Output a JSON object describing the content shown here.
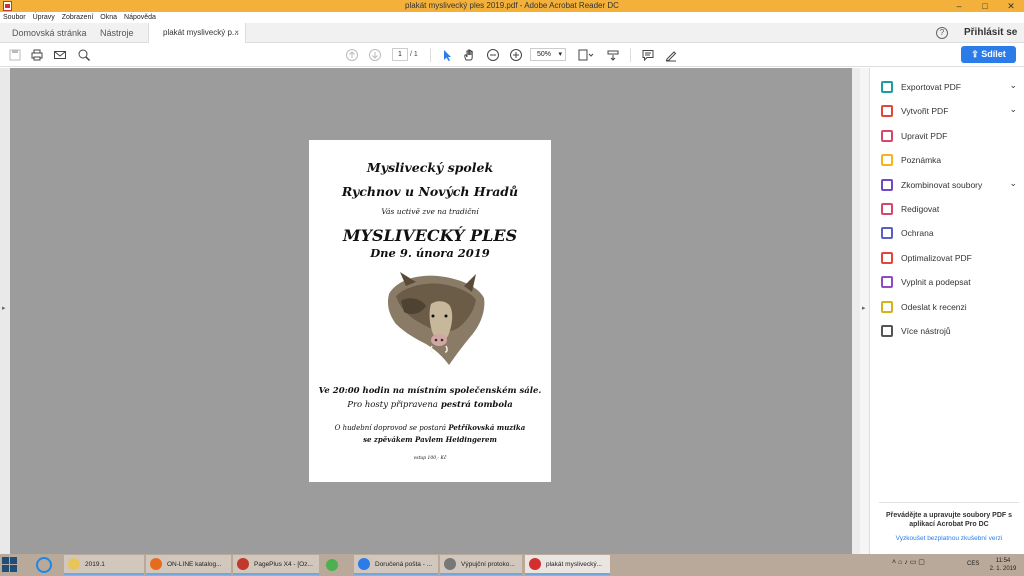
{
  "window": {
    "title": "plakát myslivecký ples 2019.pdf - Adobe Acrobat Reader DC",
    "controls": [
      "–",
      "□",
      "✕"
    ]
  },
  "menu": [
    "Soubor",
    "Úpravy",
    "Zobrazení",
    "Okna",
    "Nápověda"
  ],
  "tabs": {
    "home": "Domovská stránka",
    "tools": "Nástroje",
    "document": "plakát myslivecký p...",
    "close": "×"
  },
  "header": {
    "help": "?",
    "signin": "Přihlásit se"
  },
  "toolbar": {
    "page_current": "1",
    "page_total": "/ 1",
    "zoom": "50%",
    "share_label": "Sdílet"
  },
  "document": {
    "line1": "Myslivecký spolek",
    "line2": "Rychnov u Nových Hradů",
    "line3": "Vás uctivě zve na tradiční",
    "line4": "MYSLIVECKÝ PLES",
    "line5": "Dne 9. února 2019",
    "line6": "Ve 20:00 hodin na místním společenském sále.",
    "line7a": "Pro hosty připravena",
    "line7b": " pestrá tombola",
    "line8a": "O hudební doprovod se postará  ",
    "line8b": "Petříkovská muzika",
    "line9": "se zpěvákem Pavlem Heidingerem",
    "line10": "vstup 100,- Kč"
  },
  "right_panel": {
    "tools": [
      {
        "label": "Exportovat PDF",
        "color": "#1b9e9e",
        "chevron": true
      },
      {
        "label": "Vytvořit PDF",
        "color": "#e0463c",
        "chevron": true
      },
      {
        "label": "Upravit PDF",
        "color": "#d9456b",
        "chevron": false
      },
      {
        "label": "Poznámka",
        "color": "#f2b422",
        "chevron": false
      },
      {
        "label": "Zkombinovat soubory",
        "color": "#6e4bc3",
        "chevron": true
      },
      {
        "label": "Redigovat",
        "color": "#d9456b",
        "chevron": false
      },
      {
        "label": "Ochrana",
        "color": "#5a5fc8",
        "chevron": false
      },
      {
        "label": "Optimalizovat PDF",
        "color": "#e0463c",
        "chevron": false
      },
      {
        "label": "Vyplnit a podepsat",
        "color": "#8e4bc3",
        "chevron": false
      },
      {
        "label": "Odeslat k recenzi",
        "color": "#d3b21b",
        "chevron": false
      },
      {
        "label": "Více nástrojů",
        "color": "#555555",
        "chevron": false
      }
    ],
    "promo_text": "Převádějte a upravujte soubory PDF s aplikací Acrobat Pro DC",
    "promo_link": "Vyzkoušet bezplatnou zkušební verzi"
  },
  "taskbar": {
    "items": [
      {
        "label": "2019.1",
        "color": "#e8c55a"
      },
      {
        "label": "ON-LINE katalog...",
        "color": "#e66b1f"
      },
      {
        "label": "PagePlus X4 - [Oz...",
        "color": "#c0392b"
      },
      {
        "label": "",
        "color": "#4caf50"
      },
      {
        "label": "Doručená pošta - ...",
        "color": "#2b7ce9"
      },
      {
        "label": "Výpujční protoko...",
        "color": "#777777"
      },
      {
        "label": "plakát myslivecký...",
        "color": "#d32f2f"
      }
    ],
    "lang": "CES",
    "time": "11:54",
    "date": "2. 1. 2019"
  }
}
